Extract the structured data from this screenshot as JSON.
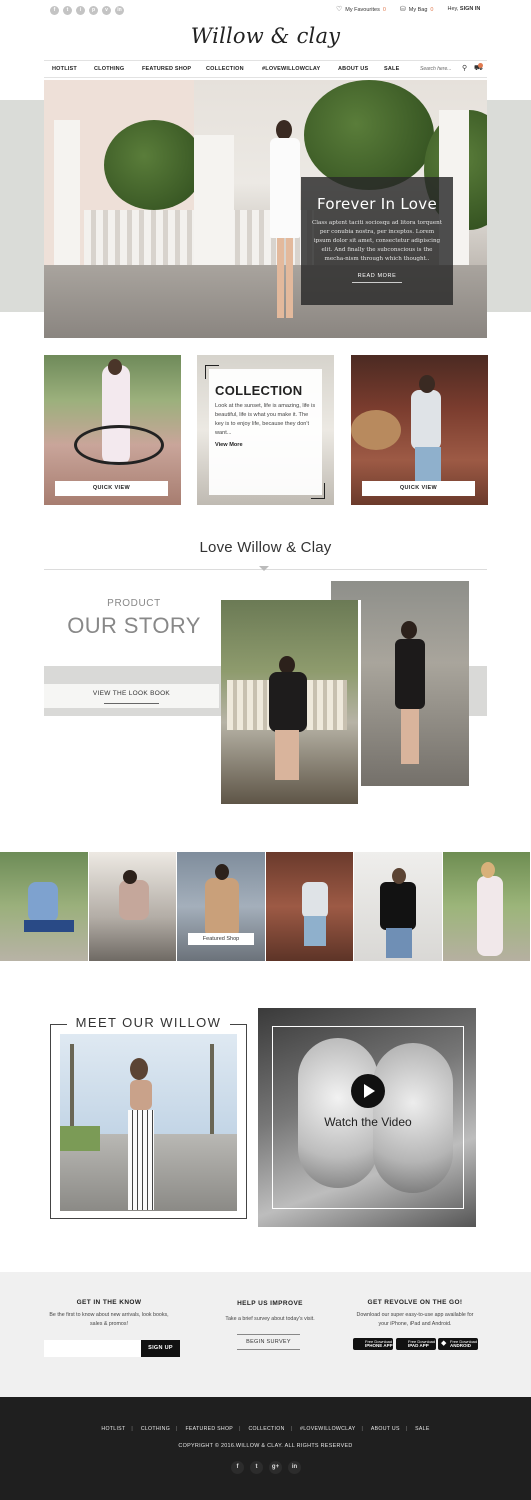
{
  "topbar": {
    "social": [
      "f",
      "t",
      "i",
      "p",
      "v",
      "in"
    ],
    "favourites_label": "My Favourites",
    "favourites_count": "0",
    "bag_label": "My Bag",
    "bag_count": "0",
    "greeting": "Hey,",
    "signin": "SIGN IN"
  },
  "brand": {
    "logo": "Willow & clay"
  },
  "nav": {
    "items": [
      "HOTLIST",
      "CLOTHING",
      "FEATURED SHOP",
      "COLLECTION",
      "#LOVEWILLOWCLAY",
      "ABOUT US",
      "SALE"
    ],
    "search_placeholder": "Search here..."
  },
  "hero": {
    "title": "Forever In Love",
    "text": "Class aptent taciti sociosqu ad litora torquent per conubia nostra, per inceptos. Lorem ipsum dolor sit amet, consectetur adipiscing elit. And finally the subconscious is the mecha-nism through which thought..",
    "read_more": "READ MORE"
  },
  "tiles": {
    "quick_view": "QUICK VIEW",
    "collection_title": "COLLECTION",
    "collection_text": "Look at the sunset, life is amazing, life is beautiful, life is what you make it. The key is to enjoy life, because they don't want...",
    "view_more": "View More"
  },
  "love": {
    "heading": "Love Willow & Clay"
  },
  "story": {
    "small": "PRODUCT",
    "big": "OUR STORY",
    "lookbook": "VIEW THE LOOK BOOK"
  },
  "strip": {
    "label": "Featured Shop"
  },
  "meet": {
    "title": "MEET OUR WILLOW"
  },
  "video": {
    "label": "Watch the Video"
  },
  "footer": {
    "col1_title": "GET IN THE KNOW",
    "col1_text": "Be the first to know about new arrivals, look books, sales & promos!",
    "signup": "SIGN UP",
    "col2_title": "HELP US IMPROVE",
    "col2_text": "Take a brief survey about today's visit.",
    "survey": "BEGIN SURVEY",
    "col3_title": "GET REVOLVE ON THE GO!",
    "col3_text": "Download our super easy-to-use app available for your iPhone, iPad and Android.",
    "apps": [
      {
        "small": "Free Download",
        "big": "IPHONE APP"
      },
      {
        "small": "Free Download",
        "big": "IPAD APP"
      },
      {
        "small": "Free Download",
        "big": "ANDROID"
      }
    ],
    "links": [
      "HOTLIST",
      "CLOTHING",
      "FEATURED SHOP",
      "COLLECTION",
      "#LOVEWILLOWCLAY",
      "ABOUT US",
      "SALE"
    ],
    "copyright": "COPYRIGHT © 2016.WILLOW & CLAY. ALL RIGHTS RESERVED",
    "social": [
      "f",
      "t",
      "g+",
      "in"
    ]
  }
}
